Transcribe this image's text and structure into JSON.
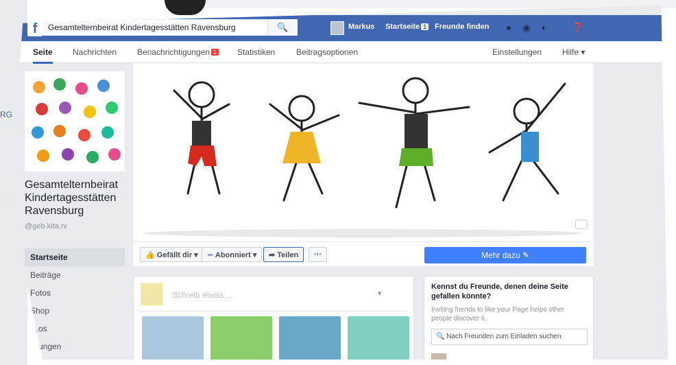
{
  "topbar": {
    "search_value": "Gesamtelternbeirat Kindertagesstätten Ravensburg",
    "user_name": "Markus",
    "home_label": "Startseite",
    "home_count": "1",
    "find_friends_label": "Freunde finden"
  },
  "nav": {
    "items": [
      "Seite",
      "Nachrichten",
      "Benachrichtigungen",
      "Statistiken",
      "Beitragsoptionen"
    ],
    "notifications_count": "1",
    "settings_label": "Einstellungen",
    "help_label": "Hilfe ▾"
  },
  "page": {
    "name": "Gesamtelternbeirat Kindertagesstätten Ravensburg",
    "handle": "@geb.kita.rv"
  },
  "sidebar": {
    "items": [
      "Startseite",
      "Beiträge",
      "Fotos",
      "Shop",
      "…os",
      "…ungen"
    ]
  },
  "actions": {
    "like_label": "Gefällt dir ▾",
    "follow_label": "Abonniert ▾",
    "share_label": "Teilen",
    "more_label": "···",
    "cta_label": "Mehr dazu ✎"
  },
  "composer": {
    "placeholder": "Schreib etwas ...",
    "audience_label": "▾"
  },
  "suggest": {
    "title": "Kennst du Freunde, denen deine Seite gefallen könnte?",
    "subtitle": "Inviting friends to like your Page helps other people discover it.",
    "search_placeholder": "Nach Freunden zum Einladen suchen"
  },
  "colors": {
    "facebook_blue": "#4267b2",
    "cta_blue": "#4080ff",
    "badge_red": "#fa3e3e",
    "background": "#e9ebee"
  },
  "icons": [
    "facebook-logo-icon",
    "search-icon",
    "friend-requests-icon",
    "messages-icon",
    "notifications-icon",
    "help-icon",
    "thumbs-up-icon",
    "rss-icon",
    "share-arrow-icon",
    "pencil-icon",
    "camera-icon"
  ]
}
